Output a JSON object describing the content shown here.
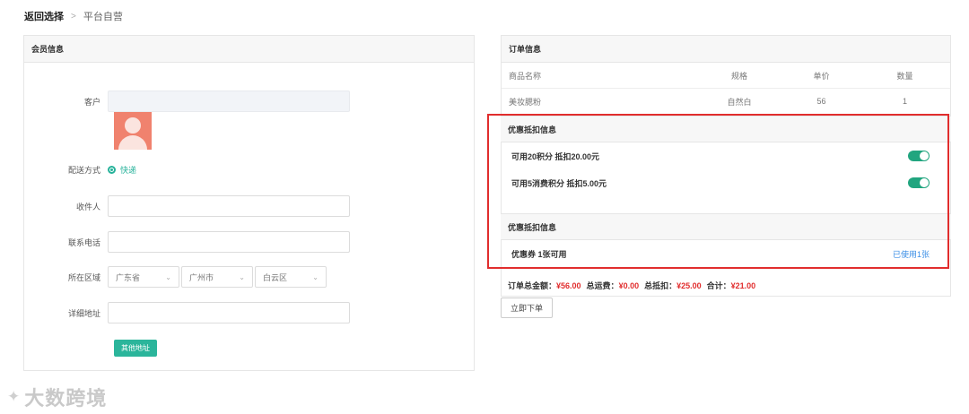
{
  "breadcrumb": {
    "back": "返回选择",
    "separator": ">",
    "current": "平台自营"
  },
  "member": {
    "title": "会员信息",
    "customer_label": "客户",
    "customer_value": "",
    "delivery_label": "配送方式",
    "delivery_option": "快递",
    "receiver_label": "收件人",
    "receiver_value": "",
    "phone_label": "联系电话",
    "phone_value": "",
    "region_label": "所在区域",
    "province": "广东省",
    "city": "广州市",
    "district": "白云区",
    "address_label": "详细地址",
    "address_value": "",
    "other_address_button": "其他地址"
  },
  "order": {
    "title": "订单信息",
    "columns": [
      "商品名称",
      "规格",
      "单价",
      "数量"
    ],
    "rows": [
      {
        "name": "美妆腮粉",
        "spec": "自然白",
        "price": "56",
        "qty": "1"
      }
    ]
  },
  "discount": {
    "title": "优惠抵扣信息",
    "items": [
      {
        "label": "可用20积分 抵扣20.00元",
        "enabled": true
      },
      {
        "label": "可用5消费积分 抵扣5.00元",
        "enabled": true
      }
    ],
    "coupon_title": "优惠抵扣信息",
    "coupon_label": "优惠券 1张可用",
    "coupon_link": "已使用1张"
  },
  "summary": {
    "total_label": "订单总金额：",
    "total_value": "¥56.00",
    "shipping_label": "总运费：",
    "shipping_value": "¥0.00",
    "deduct_label": "总抵扣：",
    "deduct_value": "¥25.00",
    "sum_label": "合计：",
    "sum_value": "¥21.00"
  },
  "submit_button": "立即下单",
  "watermark": "大数跨境",
  "colors": {
    "accent_green": "#2bb59b",
    "highlight_red": "#e12d2d",
    "link_blue": "#3a8ee6"
  }
}
